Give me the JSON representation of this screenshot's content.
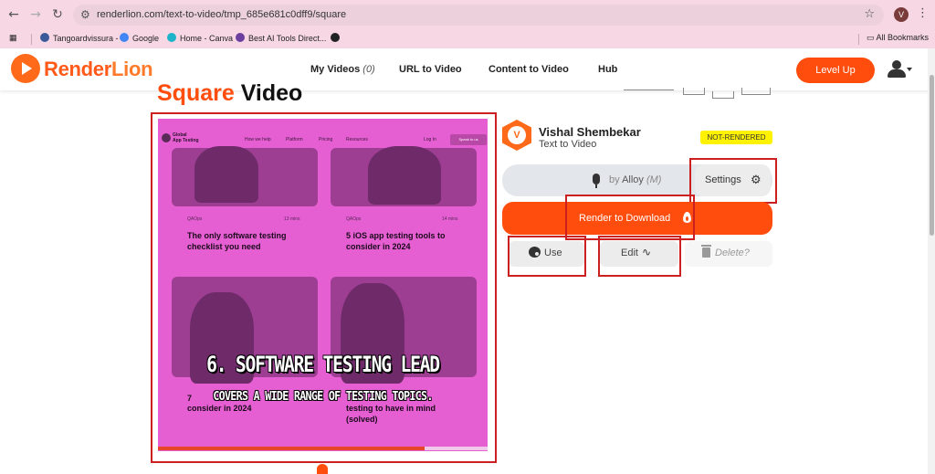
{
  "browser": {
    "url": "renderlion.com/text-to-video/tmp_685e681c0dff9/square",
    "profile_initial": "V",
    "bookmarks": [
      {
        "label": "Tangoardvissura -"
      },
      {
        "label": "Google"
      },
      {
        "label": "Home - Canva"
      },
      {
        "label": "Best AI Tools Direct..."
      }
    ],
    "all_bookmarks": "All Bookmarks"
  },
  "header": {
    "logo_part1": "Render",
    "logo_part2": "Lion",
    "nav": {
      "my_videos": "My Videos",
      "my_videos_count": "(0)",
      "url_to_video": "URL to Video",
      "content_to_video": "Content to Video",
      "hub": "Hub"
    },
    "level_up": "Level Up"
  },
  "page": {
    "title_accent": "Square",
    "title_rest": " Video"
  },
  "video": {
    "site_logo_line1": "Global",
    "site_logo_line2": "App Testing",
    "site_nav": [
      "How we help",
      "Platform",
      "Pricing",
      "Resources",
      "Log In"
    ],
    "speak_btn": "Speak to us",
    "cards": [
      {
        "tag": "QAOps",
        "time": "13 mins",
        "title": "The only software testing checklist you need"
      },
      {
        "tag": "QAOps",
        "time": "14 mins",
        "title": "5 iOS app testing tools to consider in 2024"
      }
    ],
    "partial_title_left": "7",
    "partial_title_left2": "consider in 2024",
    "partial_title_right": "testing to have in mind (solved)",
    "caption_line1": "6. SOFTWARE TESTING LEAD",
    "caption_line2": "COVERS A WIDE RANGE OF TESTING TOPICS.",
    "progress": 0.81
  },
  "panel": {
    "avatar_initial": "V",
    "author": "Vishal Shembekar",
    "subtitle": "Text to Video",
    "status": "NOT-RENDERED",
    "voice_prefix": "by",
    "voice_name": "Alloy",
    "voice_variant": "(M)",
    "settings": "Settings",
    "render": "Render to Download",
    "use": "Use",
    "edit": "Edit",
    "delete": "Delete?"
  }
}
